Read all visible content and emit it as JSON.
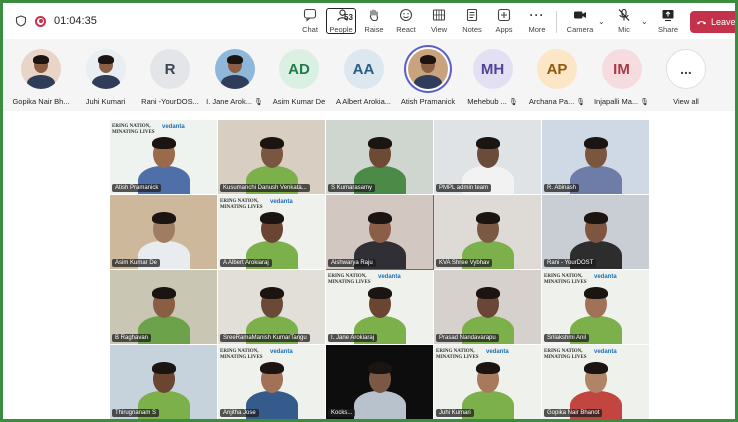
{
  "toolbar": {
    "timer": "01:04:35",
    "people_count": "53",
    "buttons": {
      "chat": "Chat",
      "people": "People",
      "raise": "Raise",
      "react": "React",
      "view": "View",
      "notes": "Notes",
      "apps": "Apps",
      "more": "More",
      "camera": "Camera",
      "mic": "Mic",
      "share": "Share",
      "leave": "Leave"
    }
  },
  "participants_bar": {
    "items": [
      {
        "name": "Gopika Nair Bh...",
        "initials": "",
        "color": "#e8d5c8",
        "photo": true,
        "muted": false
      },
      {
        "name": "Juhi Kumari",
        "initials": "",
        "color": "#e9eef2",
        "photo": true,
        "muted": false
      },
      {
        "name": "Rani -YourDOS...",
        "initials": "R",
        "color": "#e3e5e8",
        "photo": false,
        "muted": false
      },
      {
        "name": "I. Jane Arok...",
        "initials": "",
        "color": "#8fb7d9",
        "photo": true,
        "muted": true
      },
      {
        "name": "Asim Kumar De",
        "initials": "AD",
        "color": "#d9f0e3",
        "photo": false,
        "muted": false
      },
      {
        "name": "A Albert Arokia...",
        "initials": "AA",
        "color": "#dde7ef",
        "photo": false,
        "muted": false
      },
      {
        "name": "Atish Pramanick",
        "initials": "",
        "color": "#c9a27e",
        "photo": true,
        "muted": false,
        "speaking": true
      },
      {
        "name": "Mehebub ...",
        "initials": "MH",
        "color": "#e4e0f3",
        "photo": false,
        "muted": true
      },
      {
        "name": "Archana Pa...",
        "initials": "AP",
        "color": "#fbe6c6",
        "photo": false,
        "muted": true
      },
      {
        "name": "Injapalli Ma...",
        "initials": "IM",
        "color": "#f6dcde",
        "photo": false,
        "muted": true
      }
    ],
    "view_all": "View all",
    "view_all_icon": "..."
  },
  "grid": {
    "banner_text": "ERING NATION,\nMINATING LIVES",
    "brand_text": "vedanta",
    "tiles": [
      {
        "name": "Atish Pramanick",
        "bg": "#eef3ef",
        "skin": "#9a6a4a",
        "shirt": "#4f6fa8",
        "banner": true
      },
      {
        "name": "Kusumanchi Danush Venkata...",
        "bg": "#d8cfc2",
        "skin": "#7a5540",
        "shirt": "#7bb04a",
        "banner": false
      },
      {
        "name": "S Kumarasamy",
        "bg": "#cfd6cf",
        "skin": "#6e4a35",
        "shirt": "#4c8a48",
        "banner": false
      },
      {
        "name": "PMPL admin team",
        "bg": "#dfe3e6",
        "skin": "#6b4b3a",
        "shirt": "#f2f2f2",
        "banner": false
      },
      {
        "name": "R. Abinash",
        "bg": "#cfd9e6",
        "skin": "#7b563f",
        "shirt": "#6d7da8",
        "banner": false
      },
      {
        "name": "Asim Kumar De",
        "bg": "#cdb89c",
        "skin": "#a07c62",
        "shirt": "#e8ecef",
        "banner": false
      },
      {
        "name": "A Albert Arokiaraj",
        "bg": "#eef1ec",
        "skin": "#6a4532",
        "shirt": "#7bb04a",
        "banner": true
      },
      {
        "name": "Aishwarya Raju",
        "bg": "#d3c7c1",
        "skin": "#8a5e47",
        "shirt": "#2f2f35",
        "banner": false,
        "speaking": true
      },
      {
        "name": "KVA Shree Vybhav",
        "bg": "#dedad6",
        "skin": "#7a5843",
        "shirt": "#7bb04a",
        "banner": false
      },
      {
        "name": "Rani - YourDOST",
        "bg": "#c9ced4",
        "skin": "#7e563f",
        "shirt": "#2d2d2d",
        "banner": false
      },
      {
        "name": "B Raghavan",
        "bg": "#c9c6b4",
        "skin": "#8a5e43",
        "shirt": "#6ba24a",
        "banner": false
      },
      {
        "name": "SreeRamaManish KumarTangu",
        "bg": "#e2dfd9",
        "skin": "#6b4937",
        "shirt": "#7bb04a",
        "banner": false
      },
      {
        "name": "I. Jane Arokiaraj",
        "bg": "#eef1ec",
        "skin": "#6a4532",
        "shirt": "#7bb04a",
        "banner": true
      },
      {
        "name": "Prasad Nandavarapu",
        "bg": "#d6d1cc",
        "skin": "#6b4636",
        "shirt": "#7bb04a",
        "banner": false
      },
      {
        "name": "Srilakshmi Anil",
        "bg": "#eef1ec",
        "skin": "#a07358",
        "shirt": "#7bb04a",
        "banner": true
      },
      {
        "name": "Thirugnanam S",
        "bg": "#c6d2dc",
        "skin": "#6a4532",
        "shirt": "#7bb04a",
        "banner": false
      },
      {
        "name": "Anjitha Jose",
        "bg": "#eef1ec",
        "skin": "#a07358",
        "shirt": "#355a8c",
        "banner": true
      },
      {
        "name": "Kocks...",
        "bg": "#0d0d0d",
        "skin": "#7a5843",
        "shirt": "#b8c2cc",
        "banner": false
      },
      {
        "name": "Juhi Kumari",
        "bg": "#eef1ec",
        "skin": "#a77a5d",
        "shirt": "#7bb04a",
        "banner": true
      },
      {
        "name": "Gopika Nair Bhanot",
        "bg": "#eef1ec",
        "skin": "#b08466",
        "shirt": "#c2453f",
        "banner": true
      }
    ]
  },
  "colors": {
    "accent": "#5b5fc7",
    "leave": "#c4314b",
    "frame": "#3a8d3e"
  }
}
